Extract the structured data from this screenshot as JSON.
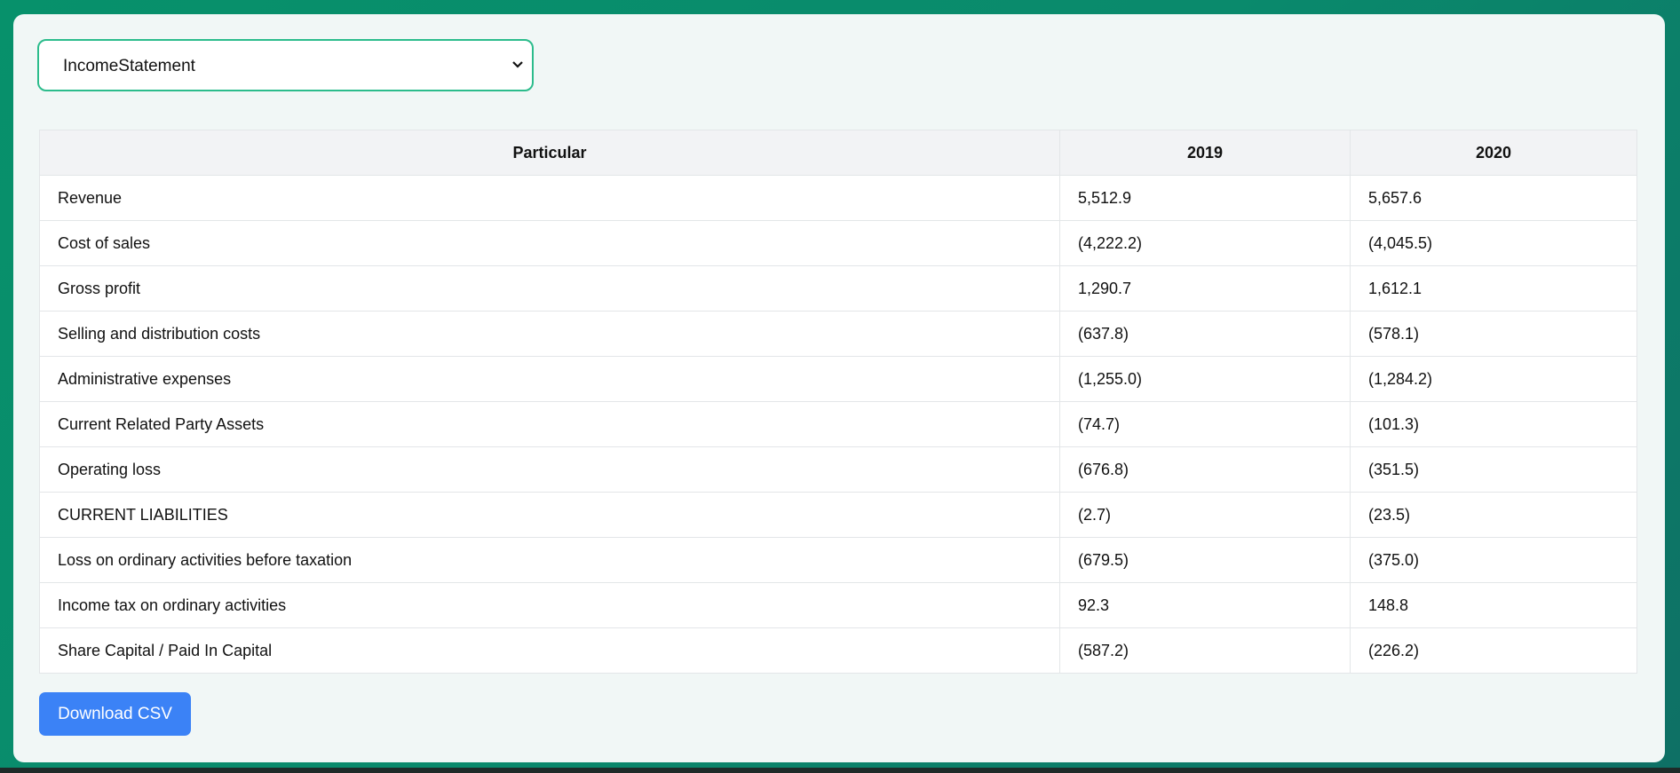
{
  "select": {
    "value": "IncomeStatement"
  },
  "table": {
    "headers": [
      "Particular",
      "2019",
      "2020"
    ],
    "rows": [
      [
        "Revenue",
        "5,512.9",
        "5,657.6"
      ],
      [
        "Cost of sales",
        "(4,222.2)",
        "(4,045.5)"
      ],
      [
        "Gross profit",
        "1,290.7",
        "1,612.1"
      ],
      [
        "Selling and distribution costs",
        "(637.8)",
        "(578.1)"
      ],
      [
        "Administrative expenses",
        "(1,255.0)",
        "(1,284.2)"
      ],
      [
        "Current Related Party Assets",
        "(74.7)",
        "(101.3)"
      ],
      [
        "Operating loss",
        "(676.8)",
        "(351.5)"
      ],
      [
        "CURRENT LIABILITIES",
        "(2.7)",
        "(23.5)"
      ],
      [
        "Loss on ordinary activities before taxation",
        "(679.5)",
        "(375.0)"
      ],
      [
        "Income tax on ordinary activities",
        "92.3",
        "148.8"
      ],
      [
        "Share Capital / Paid In Capital",
        "(587.2)",
        "(226.2)"
      ]
    ]
  },
  "download_label": "Download CSV",
  "colors": {
    "accent": "#2cbc8c",
    "button": "#3b82f6",
    "background": "#07916b"
  }
}
